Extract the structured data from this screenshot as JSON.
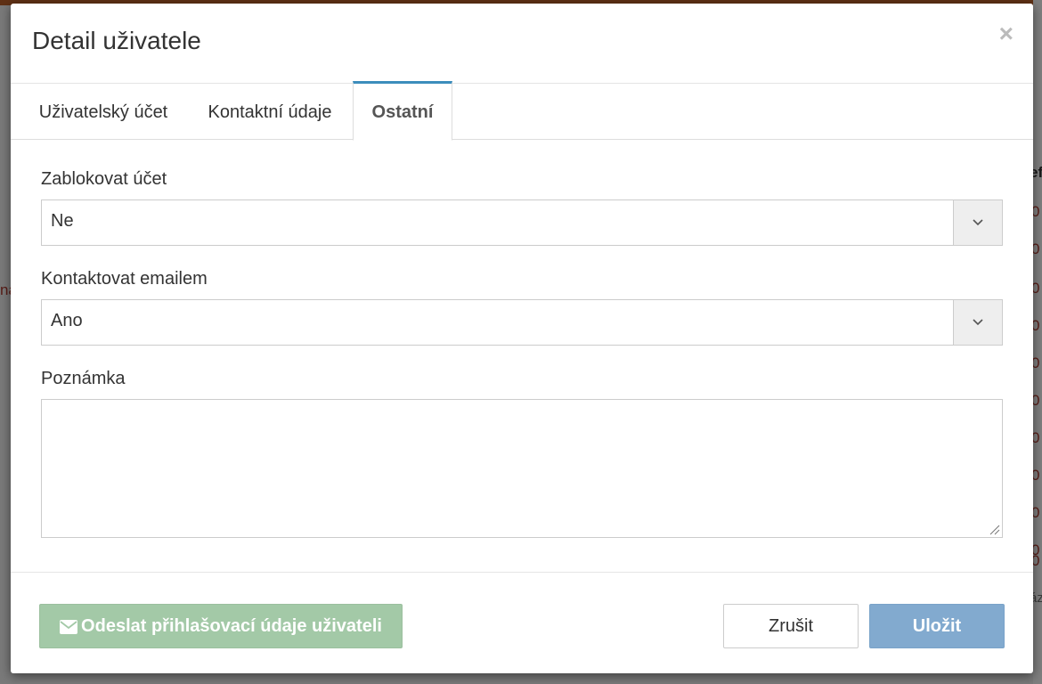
{
  "background": {
    "header_cell": "ef",
    "left_cell": "na",
    "cells": [
      "0",
      "0",
      "0",
      "0",
      "0",
      "0",
      "0",
      "0",
      "0",
      "0",
      "0"
    ],
    "footer_cell": "áz"
  },
  "modal": {
    "title": "Detail uživatele",
    "close_symbol": "×"
  },
  "tabs": [
    {
      "label": "Uživatelský účet",
      "active": false
    },
    {
      "label": "Kontaktní údaje",
      "active": false
    },
    {
      "label": "Ostatní",
      "active": true
    }
  ],
  "form": {
    "block_account": {
      "label": "Zablokovat účet",
      "value": "Ne"
    },
    "contact_email": {
      "label": "Kontaktovat emailem",
      "value": "Ano"
    },
    "note": {
      "label": "Poznámka",
      "value": ""
    }
  },
  "footer": {
    "send_credentials_label": "Odeslat přihlašovací údaje uživateli",
    "cancel_label": "Zrušit",
    "save_label": "Uložit"
  },
  "colors": {
    "tab_accent": "#3c8dbc",
    "send_button": "#a3c9a7",
    "save_button": "#82aacf",
    "top_bar": "#c0622a"
  },
  "icons": {
    "close": "close-icon",
    "select_arrow": "chevron-down-icon",
    "send": "envelope-icon",
    "resize": "resize-handle-icon"
  }
}
